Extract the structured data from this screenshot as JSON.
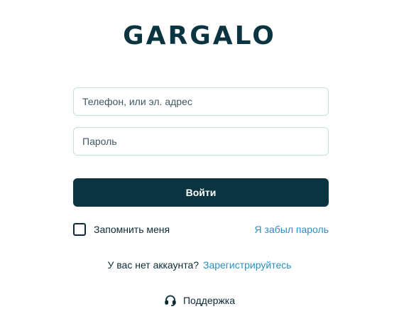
{
  "brand": {
    "logo_text": "GARGALO"
  },
  "form": {
    "login_placeholder": "Телефон, или эл. адрес",
    "login_value": "",
    "password_placeholder": "Пароль",
    "password_value": "",
    "submit_label": "Войти",
    "remember_label": "Запомнить меня",
    "remember_checked": false,
    "forgot_label": "Я забыл пароль"
  },
  "register": {
    "prompt": "У вас нет аккаунта?",
    "link_label": "Зарегистрируйтесь"
  },
  "support": {
    "label": "Поддержка",
    "icon": "headset-icon"
  },
  "colors": {
    "brand": "#0a3440",
    "link": "#2b8fc0",
    "field_border": "#c7dde0",
    "text": "#0c2a35"
  }
}
